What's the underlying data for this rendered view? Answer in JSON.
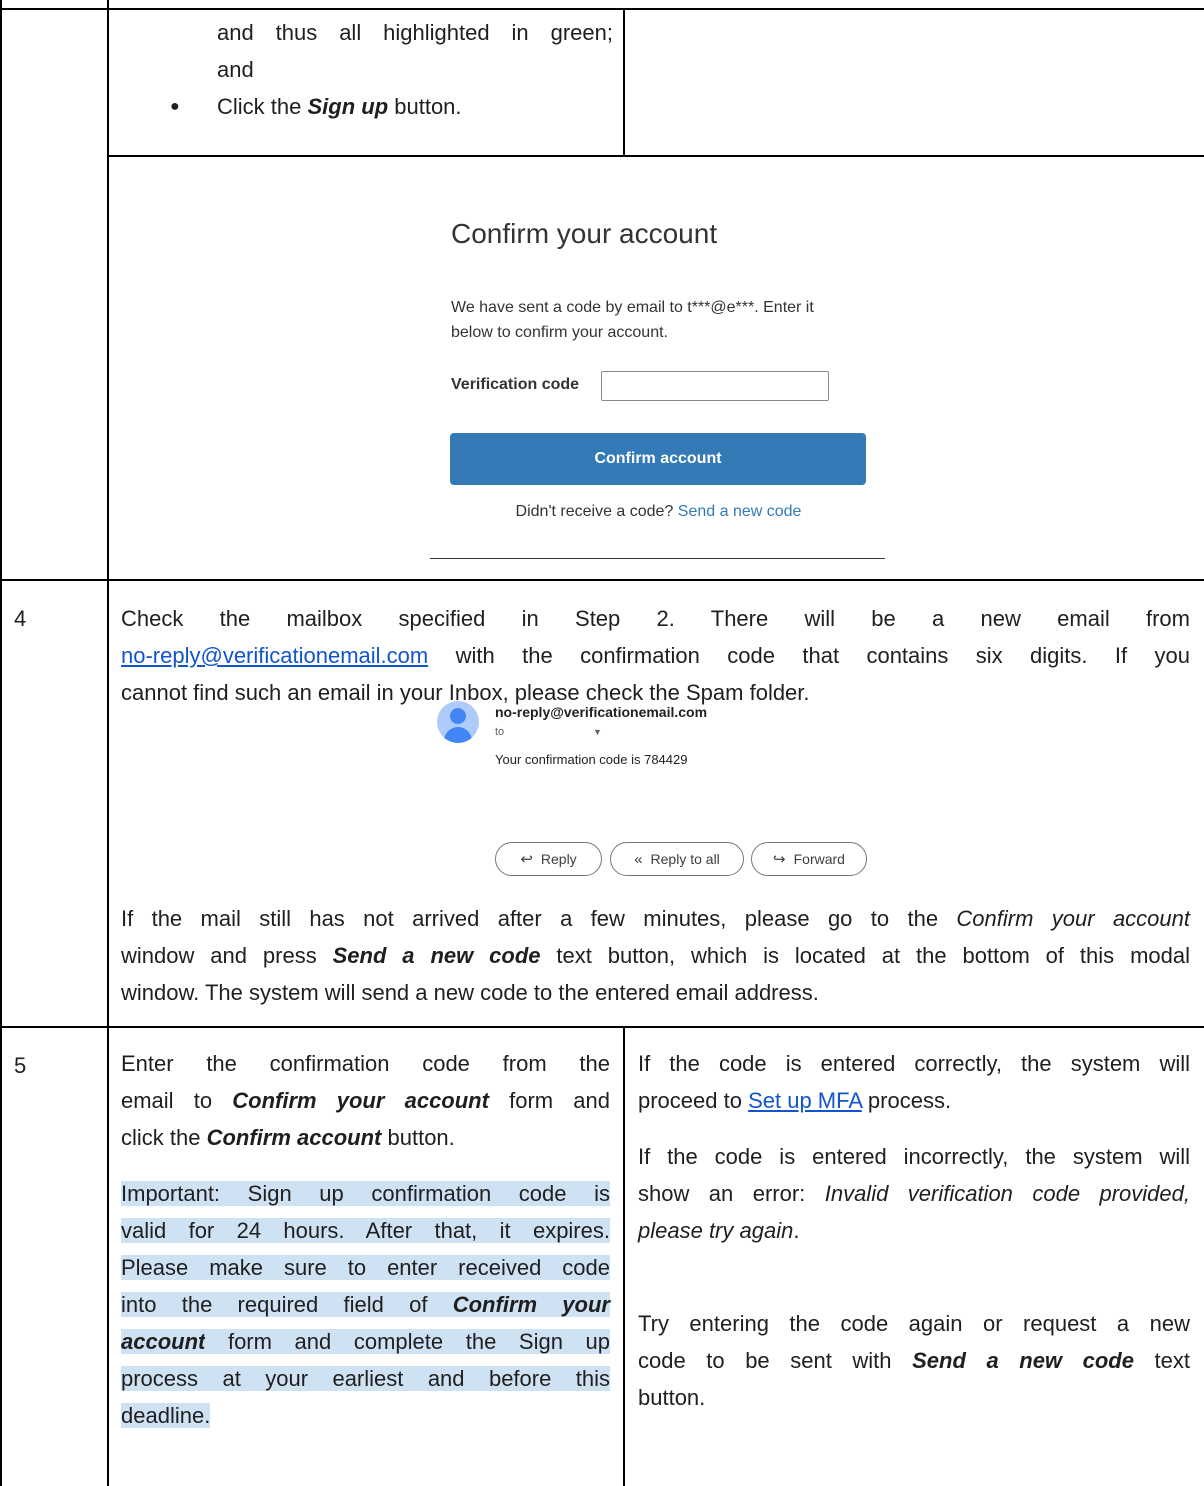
{
  "row3_top": {
    "line1": "and thus all highlighted in green;",
    "line2": "and",
    "bullet": "●",
    "bullet_prefix": "Click the ",
    "bullet_bold": "Sign up",
    "bullet_suffix": " button."
  },
  "modal": {
    "title": "Confirm your account",
    "desc_line1": "We have sent a code by email to t***@e***. Enter it",
    "desc_line2": "below to confirm your account.",
    "code_label": "Verification code",
    "code_value": "",
    "confirm_button": "Confirm account",
    "resend_prefix": "Didn't receive a code? ",
    "resend_link": "Send a new code"
  },
  "step4": {
    "number": "4",
    "l1": "Check the mailbox specified in Step 2. There will be a new email from",
    "l2_link": "no-reply@verificationemail.com",
    "l2_rest": " with the confirmation code that contains six digits. If you",
    "l3": "cannot find such an email in your Inbox, please check the Spam folder.",
    "email": {
      "from": "no-reply@verificationemail.com",
      "to": "to",
      "body": "Your confirmation code is 784429",
      "reply": "Reply",
      "reply_all": "Reply to all",
      "forward": "Forward"
    },
    "p2_l1_a": "If the mail still has not arrived after a few minutes, please go to the ",
    "p2_l1_b": "Confirm your account",
    "p2_l2_a": "window and press ",
    "p2_l2_b": "Send a new code",
    "p2_l2_c": " text button, which is located at the bottom of this modal",
    "p2_l3": "window. The system will send a new code to the entered email address."
  },
  "step5": {
    "number": "5",
    "left": {
      "l1": "Enter the confirmation code from the",
      "l2_a": "email to ",
      "l2_b": "Confirm your account",
      "l2_c": " form and",
      "l3_a": "click the ",
      "l3_b": "Confirm account",
      "l3_c": " button.",
      "imp1": "Important: Sign up confirmation code is",
      "imp2": "valid for 24 hours. After that, it expires.",
      "imp3": "Please make sure to enter received code",
      "imp4_a": "into the required field of ",
      "imp4_b": "Confirm your",
      "imp5_a": "account",
      "imp5_b": " form and complete the Sign up",
      "imp6": "process at your earliest and before this",
      "imp7": "deadline."
    },
    "right": {
      "p1_l1": "If the code is entered correctly, the system will",
      "p1_l2_a": "proceed to ",
      "p1_l2_link": "Set up MFA",
      "p1_l2_c": " process.",
      "p2_l1": "If the code is entered incorrectly, the system will",
      "p2_l2_a": "show an error: ",
      "p2_l2_b": "Invalid verification code provided,",
      "p2_l3_a": "please try again",
      "p2_l3_b": ".",
      "p3_l1": "Try entering the code again or request a new",
      "p3_l2_a": "code to be sent with ",
      "p3_l2_b": "Send a new code",
      "p3_l2_c": " text",
      "p3_l3": "button."
    }
  }
}
